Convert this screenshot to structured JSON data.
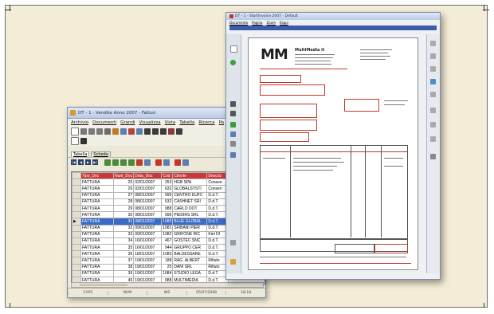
{
  "app": {
    "window_title": "DT - 1 - Vendite Anno 2007 - Fatturi",
    "menu": [
      "Archivio",
      "Documenti",
      "Grandi",
      "Visualizza",
      "Vista",
      "Tabella",
      "Ricerca",
      "Pa"
    ]
  },
  "tabs": [
    "Tabella",
    "Scheda"
  ],
  "grid": {
    "columns": [
      "Tipo_Doc",
      "Num_Doc",
      "Data_Doc",
      "Cod",
      "Cliente",
      "Descriz"
    ],
    "rows": [
      [
        "FATTURA",
        "25",
        "02/01/2007",
        "253",
        "HGB SPA",
        "Consen"
      ],
      [
        "FATTURA",
        "26",
        "02/01/2007",
        "632",
        "GLOBALSYSTI",
        "Consen"
      ],
      [
        "FATTURA",
        "27",
        "08/01/2007",
        "996",
        "CENTRO EUFC",
        "D.d.T."
      ],
      [
        "FATTURA",
        "28",
        "08/01/2007",
        "532",
        "CASHNET SRI",
        "D.d.T."
      ],
      [
        "FATTURA",
        "29",
        "08/01/2007",
        "988",
        "CARLO DOT",
        "D.d.T."
      ],
      [
        "FATTURA",
        "30",
        "08/01/2007",
        "996",
        "PIEDIRS SRL",
        "D.d.T."
      ],
      [
        "FATTURA",
        "31",
        "08/01/2007",
        "1080",
        "BLUE GLOBAL",
        "D.d.T."
      ],
      [
        "FATTURA",
        "32",
        "09/01/2007",
        "1081",
        "SFIBANI PIER",
        "D.d.T."
      ],
      [
        "FATTURA",
        "33",
        "09/01/2007",
        "1082",
        "GRIFONE RIC",
        "Kiel DI"
      ],
      [
        "FATTURA",
        "34",
        "16/01/2007",
        "467",
        "GOSTEC SNC",
        "D.d.T."
      ],
      [
        "FATTURA",
        "35",
        "16/01/2007",
        "944",
        "GRUPPO CER",
        "D.d.T."
      ],
      [
        "FATTURA",
        "36",
        "18/01/2007",
        "1083",
        "BALDESSARE",
        "D.d.T."
      ],
      [
        "FATTURA",
        "37",
        "19/01/2007",
        "188",
        "RAG. ALBERT",
        "Rifiuto"
      ],
      [
        "FATTURA",
        "38",
        "19/01/2007",
        "25",
        "DANI SRL",
        "Rifiuto"
      ],
      [
        "FATTURA",
        "39",
        "19/01/2007",
        "1084",
        "STUDIO LEGA",
        "D.d.T."
      ],
      [
        "FATTURA",
        "40",
        "19/01/2007",
        "988",
        "MULTIMEDIA",
        "D.d.T."
      ],
      [
        "FATTURA",
        "41",
        "22/01/2007",
        "1086",
        "TAVELLA SOT",
        "D.d.T."
      ]
    ],
    "selected_row": 6
  },
  "status": [
    "CAPS",
    "NUM",
    "INS",
    "05/07/2008",
    "18:18"
  ],
  "viewer": {
    "window_title": "DT - 1 - StartInvoice 2007 - Default",
    "menu": [
      "Documento",
      "Pagina",
      "Zoom",
      "Esqui"
    ],
    "logo_text": "MM",
    "company_name": "MultiMedia it"
  }
}
